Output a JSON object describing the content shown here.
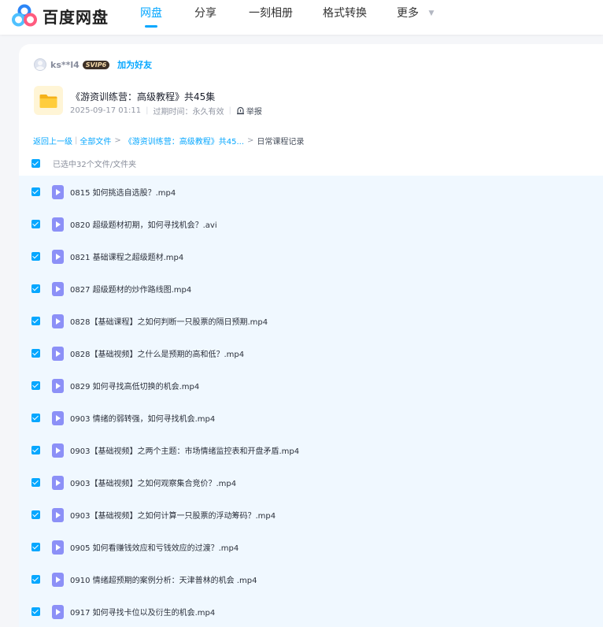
{
  "header": {
    "logo_text": "百度网盘",
    "nav": [
      {
        "label": "网盘",
        "active": true
      },
      {
        "label": "分享",
        "active": false
      },
      {
        "label": "一刻相册",
        "active": false
      },
      {
        "label": "格式转换",
        "active": false
      },
      {
        "label": "更多",
        "active": false
      }
    ],
    "accent_color": "#06a7ff"
  },
  "share": {
    "username": "ks**l4",
    "vip_badge": "SVIP6",
    "add_friend": "加为好友",
    "title": "《游资训练营：高级教程》共45集",
    "date": "2025-09-17 01:11",
    "expiry": "过期时间：永久有效",
    "report": "举报"
  },
  "breadcrumb": {
    "back": "返回上一级",
    "all_files": "全部文件",
    "folder": "《游资训练营：高级教程》共45...",
    "current": "日常课程记录"
  },
  "selection": {
    "label": "已选中32个文件/文件夹"
  },
  "files": [
    "0815 如何挑选自选股？.mp4",
    "0820 超级题材初期，如何寻找机会？.avi",
    "0821 基础课程之超级题材.mp4",
    "0827 超级题材的炒作路线图.mp4",
    "0828【基础课程】之如何判断一只股票的隔日预期.mp4",
    "0828【基础视频】之什么是预期的高和低？.mp4",
    "0829 如何寻找高低切换的机会.mp4",
    "0903 情绪的弱转强，如何寻找机会.mp4",
    "0903【基础视频】之两个主题：市场情绪监控表和开盘矛盾.mp4",
    "0903【基础视频】之如何观察集合竞价？.mp4",
    "0903【基础视频】之如何计算一只股票的浮动筹码？.mp4",
    "0905 如何看赚钱效应和亏钱效应的过渡？.mp4",
    "0910 情绪超预期的案例分析：天津普林的机会 .mp4",
    "0917 如何寻找卡位以及衍生的机会.mp4"
  ]
}
